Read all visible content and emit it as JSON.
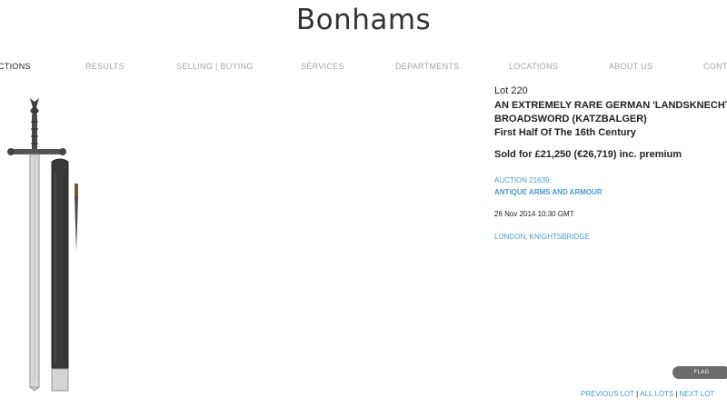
{
  "brand": {
    "logo_text": "Bonhams"
  },
  "nav": {
    "auctions": "CTIONS",
    "results": "RESULTS",
    "selling": "SELLING",
    "divider": "|",
    "buying": "BUYING",
    "services": "SERVICES",
    "departments": "DEPARTMENTS",
    "locations": "LOCATIONS",
    "about": "ABOUT US",
    "contact": "CONTA"
  },
  "lot": {
    "number": "Lot 220",
    "title_line1": "AN EXTREMELY RARE GERMAN 'LANDSKNECHT'",
    "title_line2": "BROADSWORD (KATZBALGER)",
    "subtitle": "First Half Of The 16th Century",
    "sold_price": "Sold for £21,250 (€26,719) inc. premium",
    "image": "sword-and-scabbard"
  },
  "sale": {
    "auction_number": "AUCTION 21639:",
    "name": "ANTIQUE ARMS AND ARMOUR",
    "date": "26 Nov 2014 10:30 GMT",
    "location": "LONDON, KNIGHTSBRIDGE"
  },
  "actions": {
    "flag": "FLAG"
  },
  "lot_nav": {
    "previous": "PREVIOUS LOT",
    "all": "ALL LOTS",
    "next": "NEXT LOT",
    "separator": "|"
  },
  "colors": {
    "link": "#4a9bd1",
    "muted": "#a6a6a6",
    "text": "#222222",
    "flag_bg": "#6c6c6c"
  }
}
